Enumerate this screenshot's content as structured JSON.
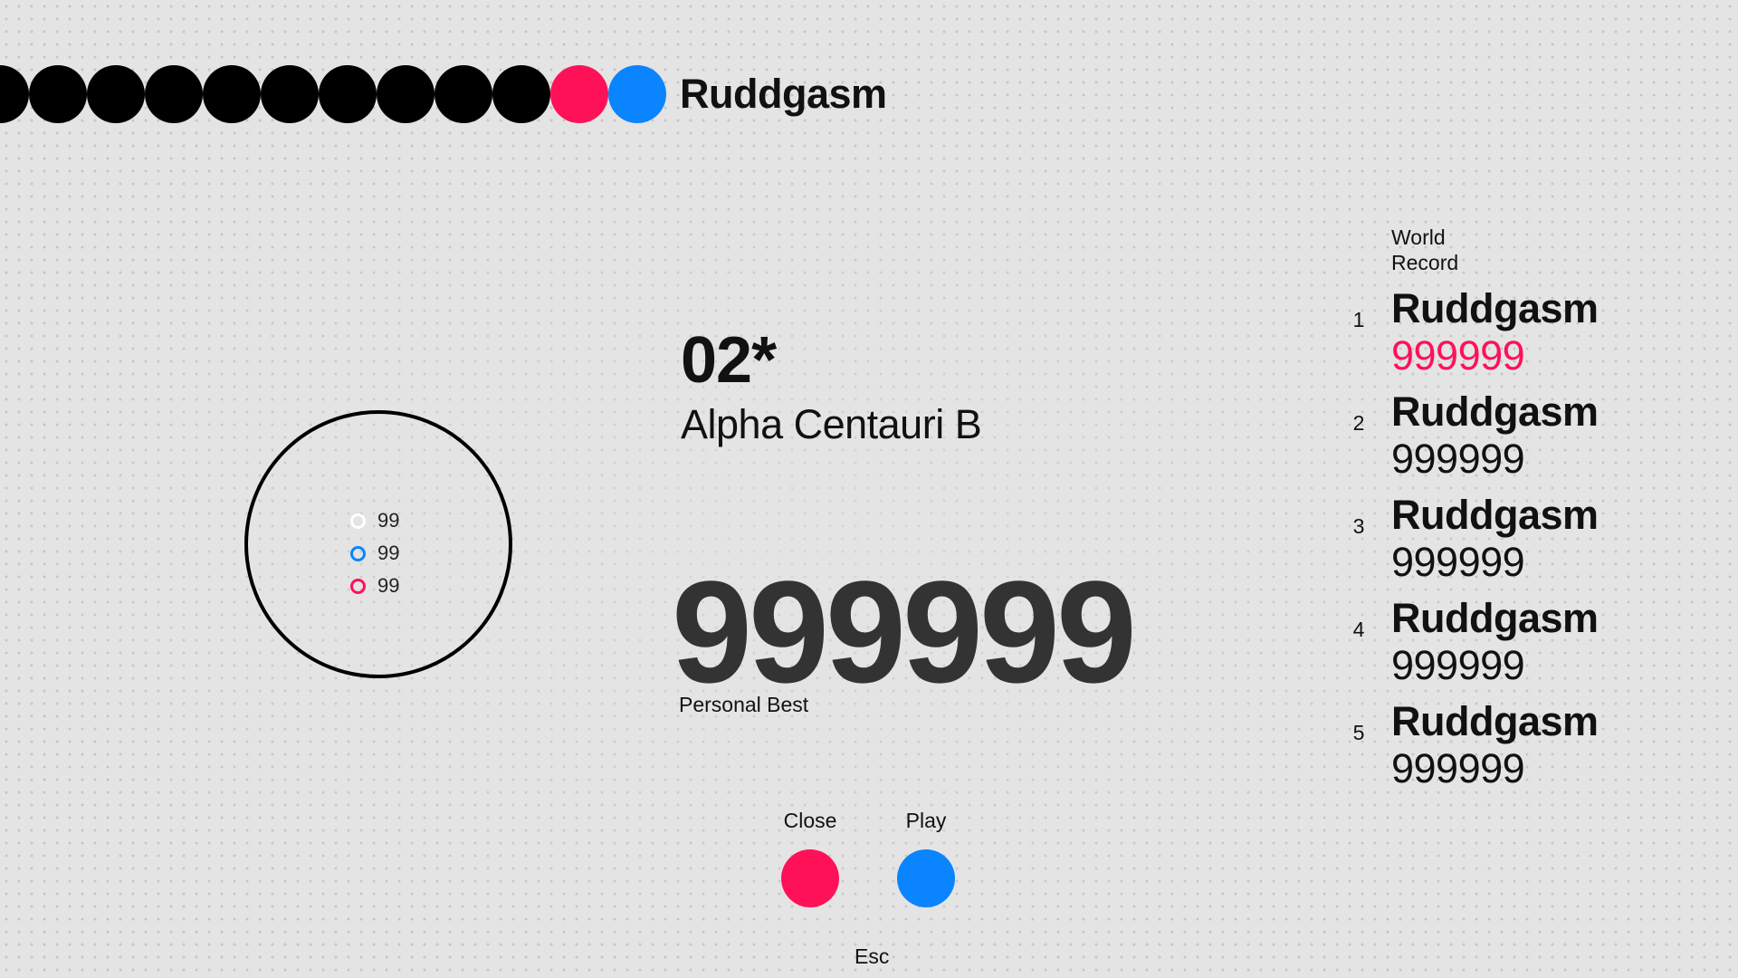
{
  "colors": {
    "accent_red": "#ff1158",
    "accent_blue": "#0a84ff",
    "dark": "#000000"
  },
  "player": {
    "name": "Ruddgasm",
    "progress_dots": [
      "black",
      "black",
      "black",
      "black",
      "black",
      "black",
      "black",
      "black",
      "black",
      "black",
      "red",
      "blue"
    ]
  },
  "stats": [
    {
      "icon": "white-ring-icon",
      "color": "#ffffff",
      "value": "99"
    },
    {
      "icon": "blue-ring-icon",
      "color": "#0a84ff",
      "value": "99"
    },
    {
      "icon": "red-ring-icon",
      "color": "#ff1158",
      "value": "99"
    }
  ],
  "level": {
    "number": "02*",
    "name": "Alpha Centauri B"
  },
  "personal_best": {
    "score": "999999",
    "label": "Personal Best"
  },
  "actions": {
    "close_label": "Close",
    "play_label": "Play",
    "esc_label": "Esc"
  },
  "world_record": {
    "title": "World Record",
    "entries": [
      {
        "rank": "1",
        "name": "Ruddgasm",
        "score": "999999",
        "highlight": true
      },
      {
        "rank": "2",
        "name": "Ruddgasm",
        "score": "999999",
        "highlight": false
      },
      {
        "rank": "3",
        "name": "Ruddgasm",
        "score": "999999",
        "highlight": false
      },
      {
        "rank": "4",
        "name": "Ruddgasm",
        "score": "999999",
        "highlight": false
      },
      {
        "rank": "5",
        "name": "Ruddgasm",
        "score": "999999",
        "highlight": false
      }
    ]
  }
}
